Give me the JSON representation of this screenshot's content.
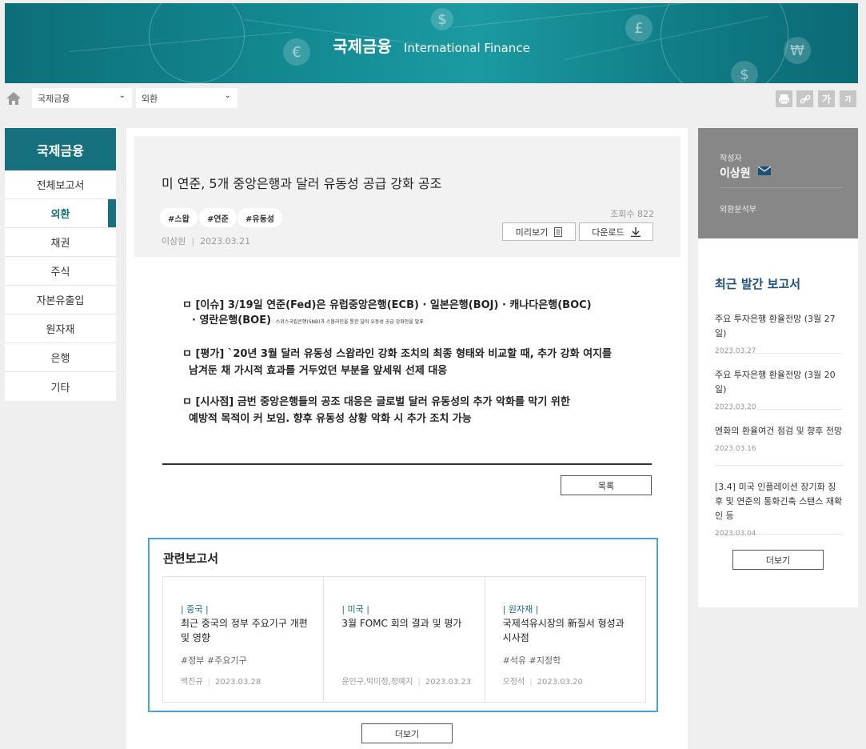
{
  "banner": {
    "title_ko": "국제금융",
    "title_en": "International Finance"
  },
  "breadcrumb": {
    "select1": "국제금융",
    "select2": "외환"
  },
  "tools": {
    "print": "print",
    "link": "link",
    "font_up": "가",
    "font_down": "가"
  },
  "sidebar": {
    "heading": "국제금융",
    "items": [
      {
        "label": "전체보고서"
      },
      {
        "label": "외환"
      },
      {
        "label": "채권"
      },
      {
        "label": "주식"
      },
      {
        "label": "자본유출입"
      },
      {
        "label": "원자재"
      },
      {
        "label": "은행"
      },
      {
        "label": "기타"
      }
    ]
  },
  "article": {
    "title": "미 연준, 5개 중앙은행과 달러 유동성 공급 강화 공조",
    "tags": [
      "#스왑",
      "#연준",
      "#유동성"
    ],
    "author": "이상원",
    "date": "2023.03.21",
    "views": "조회수 822",
    "preview_label": "미리보기",
    "download_label": "다운로드",
    "body": {
      "p1_line1": "ㅁ [이슈] 3/19일 연준(Fed)은 유럽중앙은행(ECB) · 일본은행(BOJ) · 캐나다은행(BOC)",
      "p1_line2": "· 영란은행(BOE)",
      "p1_small": " · 스위스국립은행(SNB)과 스왑라인을 통한 달러 유동성 공급 강화안을 발표",
      "p2_line1": "ㅁ [평가] `20년 3월 달러 유동성 스왑라인 강화 조치의 최종 형태와 비교할 때, 추가 강화 여지를",
      "p2_line2": "남겨둔 채 가시적 효과를 거두었던 부분을 앞세워 선제 대응",
      "p3_line1": "ㅁ [시사점] 금번 중앙은행들의 공조 대응은 글로벌 달러 유동성의 추가 악화를 막기 위한",
      "p3_line2": "예방적 목적이 커 보임. 향후 유동성 상황 악화 시 추가 조치 가능"
    },
    "list_label": "목록"
  },
  "related": {
    "title": "관련보고서",
    "items": [
      {
        "category": "| 중국 |",
        "title": "최근 중국의 정부 주요기구 개편 및 영향",
        "tags": "#정부  #주요기구",
        "author": "백진규",
        "date": "2023.03.28"
      },
      {
        "category": "| 미국 |",
        "title": "3월 FOMC 회의 결과 및 평가",
        "tags": "",
        "author": "윤인구,박미정,정예지",
        "date": "2023.03.23"
      },
      {
        "category": "| 원자재 |",
        "title": "국제석유시장의 新질서 형성과 시사점",
        "tags": "#석유  #지정학",
        "author": "오정석",
        "date": "2023.03.20"
      }
    ],
    "more_label": "더보기"
  },
  "author_panel": {
    "label": "작성자",
    "name": "이상원",
    "dept": "외환분석부"
  },
  "recent": {
    "title": "최근 발간 보고서",
    "items": [
      {
        "title": "주요 투자은행 환율전망 (3월 27일)",
        "date": "2023.03.27"
      },
      {
        "title": "주요 투자은행 환율전망 (3월 20일)",
        "date": "2023.03.20"
      },
      {
        "title": "엔화의 환율여건 점검 및 향후 전망",
        "date": "2023.03.16"
      },
      {
        "title": "[3.4] 미국 인플레이션 장기화 징후 및 연준의 통화긴축 스탠스 재확인 등",
        "date": "2023.03.04"
      }
    ],
    "more_label": "더보기"
  },
  "colors": {
    "accent": "#16707e",
    "related_border": "#4aa3df",
    "author_bg": "#878787"
  }
}
